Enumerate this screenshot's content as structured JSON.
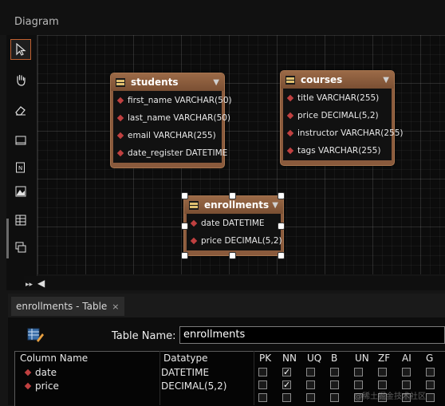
{
  "diagram": {
    "title": "Diagram"
  },
  "toolbar": {
    "tools": [
      "pointer-tool",
      "hand-tool",
      "eraser-tool",
      "layer-tool",
      "text-note-tool",
      "image-tool",
      "new-table-tool",
      "new-view-tool"
    ]
  },
  "tables": {
    "students": {
      "name": "students",
      "columns": [
        "first_name VARCHAR(50)",
        "last_name VARCHAR(50)",
        "email VARCHAR(255)",
        "date_register DATETIME"
      ]
    },
    "courses": {
      "name": "courses",
      "columns": [
        "title VARCHAR(255)",
        "price DECIMAL(5,2)",
        "instructor VARCHAR(255)",
        "tags VARCHAR(255)"
      ]
    },
    "enrollments": {
      "name": "enrollments",
      "columns": [
        "date DATETIME",
        "price DECIMAL(5,2)"
      ]
    }
  },
  "editor": {
    "tab_label": "enrollments - Table",
    "tab_close": "×",
    "table_name_label": "Table Name:",
    "table_name_value": "enrollments",
    "headers": {
      "column_name": "Column Name",
      "datatype": "Datatype",
      "pk": "PK",
      "nn": "NN",
      "uq": "UQ",
      "b": "B",
      "un": "UN",
      "zf": "ZF",
      "ai": "AI",
      "g": "G"
    },
    "rows": [
      {
        "name": "date",
        "datatype": "DATETIME",
        "nn": true
      },
      {
        "name": "price",
        "datatype": "DECIMAL(5,2)",
        "nn": true
      }
    ]
  },
  "watermark": "@稀土掘金技术社区"
}
